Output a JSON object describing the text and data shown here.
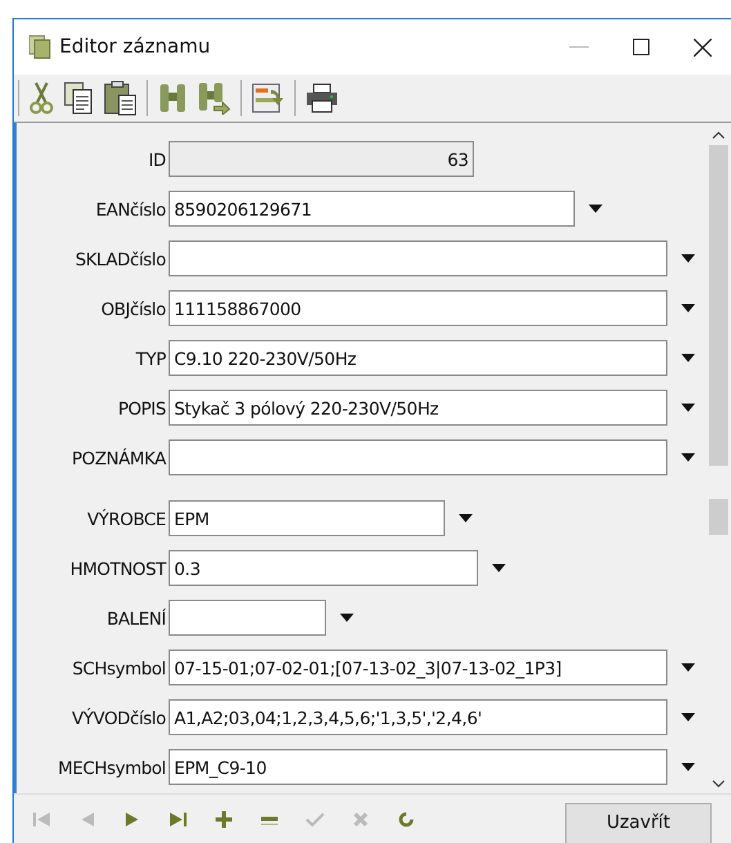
{
  "window": {
    "title": "Editor záznamu"
  },
  "fields": [
    {
      "label": "ID",
      "kind": "readonly",
      "value": "63"
    },
    {
      "label": "EANčíslo",
      "kind": "combo",
      "value": "8590206129671"
    },
    {
      "label": "SKLADčíslo",
      "kind": "combo"
    },
    {
      "label": "OBJčíslo",
      "kind": "combo",
      "value": "111158867000"
    },
    {
      "label": "TYP",
      "kind": "combo",
      "value": "C9.10 220-230V/50Hz"
    },
    {
      "label": "POPIS",
      "kind": "combo",
      "value": "Stykač 3 pólový 220-230V/50Hz"
    },
    {
      "label": "POZNÁMKA",
      "kind": "combo"
    },
    {
      "label": "VÝROBCE",
      "kind": "combo",
      "value": "EPM"
    },
    {
      "label": "HMOTNOST",
      "kind": "combo",
      "value": "0.3"
    },
    {
      "label": "BALENÍ",
      "kind": "combo"
    },
    {
      "label": "SCHsymbol",
      "kind": "combo",
      "value": "07-15-01;07-02-01;[07-13-02_3|07-13-02_1P3]"
    },
    {
      "label": "VÝVODčíslo",
      "kind": "combo",
      "value": "A1,A2;03,04;1,2,3,4,5,6;'1,3,5','2,4,6'"
    },
    {
      "label": "MECHsymbol",
      "kind": "combo",
      "value": "EPM_C9-10"
    }
  ],
  "navigator": [
    {
      "kind": "first",
      "disabled": true
    },
    {
      "kind": "prior",
      "disabled": true
    },
    {
      "kind": "next",
      "disabled": false
    },
    {
      "kind": "last",
      "disabled": false
    },
    {
      "kind": "insert",
      "disabled": false
    },
    {
      "kind": "delete",
      "disabled": false
    },
    {
      "kind": "post",
      "disabled": true
    },
    {
      "kind": "cancel",
      "disabled": true
    },
    {
      "kind": "refresh",
      "disabled": false
    }
  ],
  "close_button": {
    "label": "Uzavřít"
  }
}
